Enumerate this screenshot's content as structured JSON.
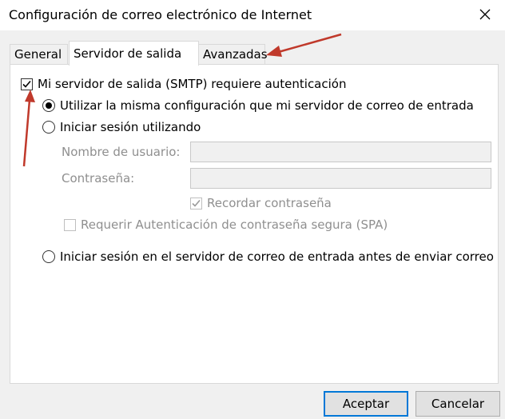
{
  "window": {
    "title": "Configuración de correo electrónico de Internet",
    "close_icon": "close-icon"
  },
  "tabs": [
    {
      "label": "General",
      "active": false
    },
    {
      "label": "Servidor de salida",
      "active": true
    },
    {
      "label": "Avanzadas",
      "active": false
    }
  ],
  "smtp_auth": {
    "label": "Mi servidor de salida (SMTP) requiere autenticación",
    "checked": true
  },
  "options": {
    "same_config": {
      "label": "Utilizar la misma configuración que mi servidor de correo de entrada",
      "selected": true
    },
    "login_with": {
      "label": "Iniciar sesión utilizando",
      "selected": false
    },
    "login_before_send": {
      "label": "Iniciar sesión en el servidor de correo de entrada antes de enviar correo",
      "selected": false
    }
  },
  "login_fields": {
    "username_label": "Nombre de usuario:",
    "username_value": "",
    "password_label": "Contraseña:",
    "password_value": "",
    "remember_password": {
      "label": "Recordar contraseña",
      "checked": true
    },
    "spa": {
      "label": "Requerir Autenticación de contraseña segura (SPA)",
      "checked": false
    }
  },
  "buttons": {
    "accept": "Aceptar",
    "cancel": "Cancelar"
  },
  "colors": {
    "annotation_arrow": "#c0392b",
    "accent": "#0078d7"
  }
}
